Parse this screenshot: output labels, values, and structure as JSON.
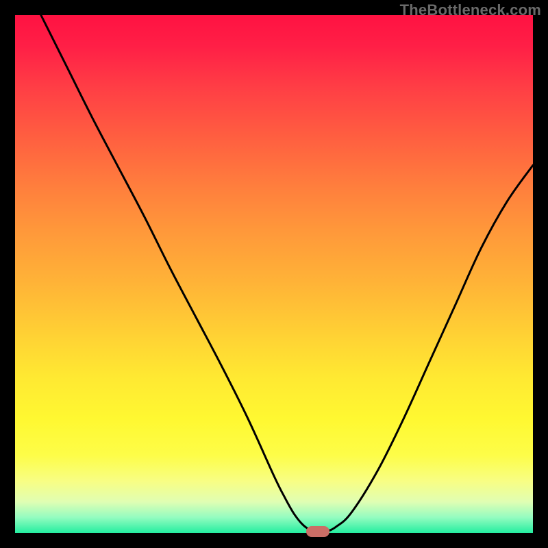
{
  "watermark": "TheBottleneck.com",
  "colors": {
    "curve_stroke": "#000000",
    "marker_fill": "#cb6e66"
  },
  "chart_data": {
    "type": "line",
    "title": "",
    "xlabel": "",
    "ylabel": "",
    "xlim": [
      0,
      100
    ],
    "ylim": [
      0,
      100
    ],
    "grid": false,
    "legend": false,
    "annotations": [],
    "series": [
      {
        "name": "curve",
        "x": [
          5,
          10,
          15,
          20,
          25,
          30,
          35,
          40,
          45,
          50,
          52,
          54,
          56,
          58,
          60,
          62,
          65,
          70,
          75,
          80,
          85,
          90,
          95,
          100
        ],
        "y": [
          100,
          90,
          80,
          70.5,
          61,
          51,
          41.5,
          32,
          22,
          11,
          7,
          3.5,
          1.2,
          0.3,
          0.3,
          1.2,
          4,
          12,
          22,
          33,
          44,
          55,
          64,
          71
        ]
      }
    ],
    "marker": {
      "x": 58.5,
      "y": 0.2
    }
  }
}
